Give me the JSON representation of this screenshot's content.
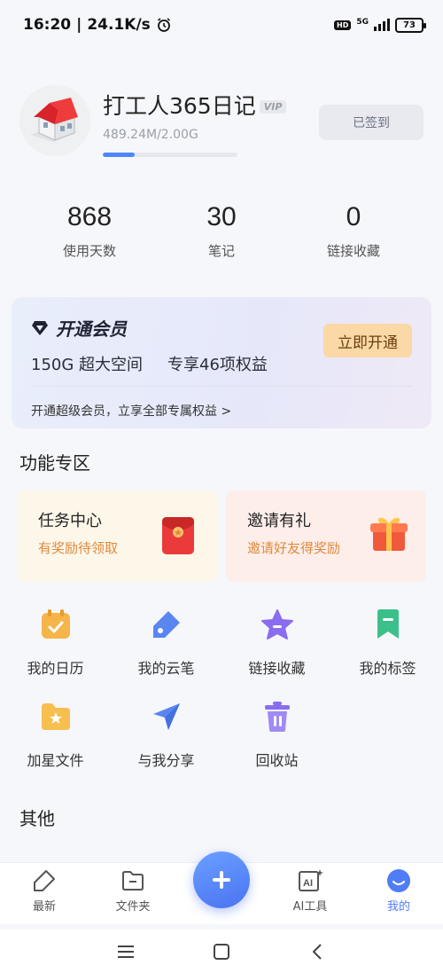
{
  "status_bar": {
    "time": "16:20",
    "speed": "24.1K/s",
    "battery": "73",
    "network": "5G"
  },
  "profile": {
    "username": "打工人365日记",
    "vip_badge": "VIP",
    "storage_text": "489.24M/2.00G",
    "storage_used_fraction": 0.24,
    "signin_label": "已签到"
  },
  "stats": [
    {
      "value": "868",
      "label": "使用天数"
    },
    {
      "value": "30",
      "label": "笔记"
    },
    {
      "value": "0",
      "label": "链接收藏"
    }
  ],
  "vip_card": {
    "title": "开通会员",
    "desc_1": "150G 超大空间",
    "desc_2": "专享46项权益",
    "button": "立即开通",
    "link": "开通超级会员，立享全部专属权益 >"
  },
  "section_features": "功能专区",
  "feature_cards": [
    {
      "title": "任务中心",
      "subtitle": "有奖励待领取"
    },
    {
      "title": "邀请有礼",
      "subtitle": "邀请好友得奖励"
    }
  ],
  "grid": [
    {
      "label": "我的日历",
      "icon": "calendar-icon"
    },
    {
      "label": "我的云笔",
      "icon": "pen-tag-icon"
    },
    {
      "label": "链接收藏",
      "icon": "star-icon"
    },
    {
      "label": "我的标签",
      "icon": "bookmark-icon"
    },
    {
      "label": "加星文件",
      "icon": "starred-folder-icon"
    },
    {
      "label": "与我分享",
      "icon": "send-icon"
    },
    {
      "label": "回收站",
      "icon": "trash-icon"
    }
  ],
  "section_other": "其他",
  "bottom_nav": [
    {
      "label": "最新",
      "icon": "tag-icon"
    },
    {
      "label": "文件夹",
      "icon": "folder-icon"
    },
    {
      "label": "AI工具",
      "icon": "ai-icon"
    },
    {
      "label": "我的",
      "icon": "profile-icon"
    }
  ],
  "colors": {
    "accent": "#4f7cf7",
    "vip_button": "#fad9a6",
    "reward_text": "#e08a3d"
  }
}
